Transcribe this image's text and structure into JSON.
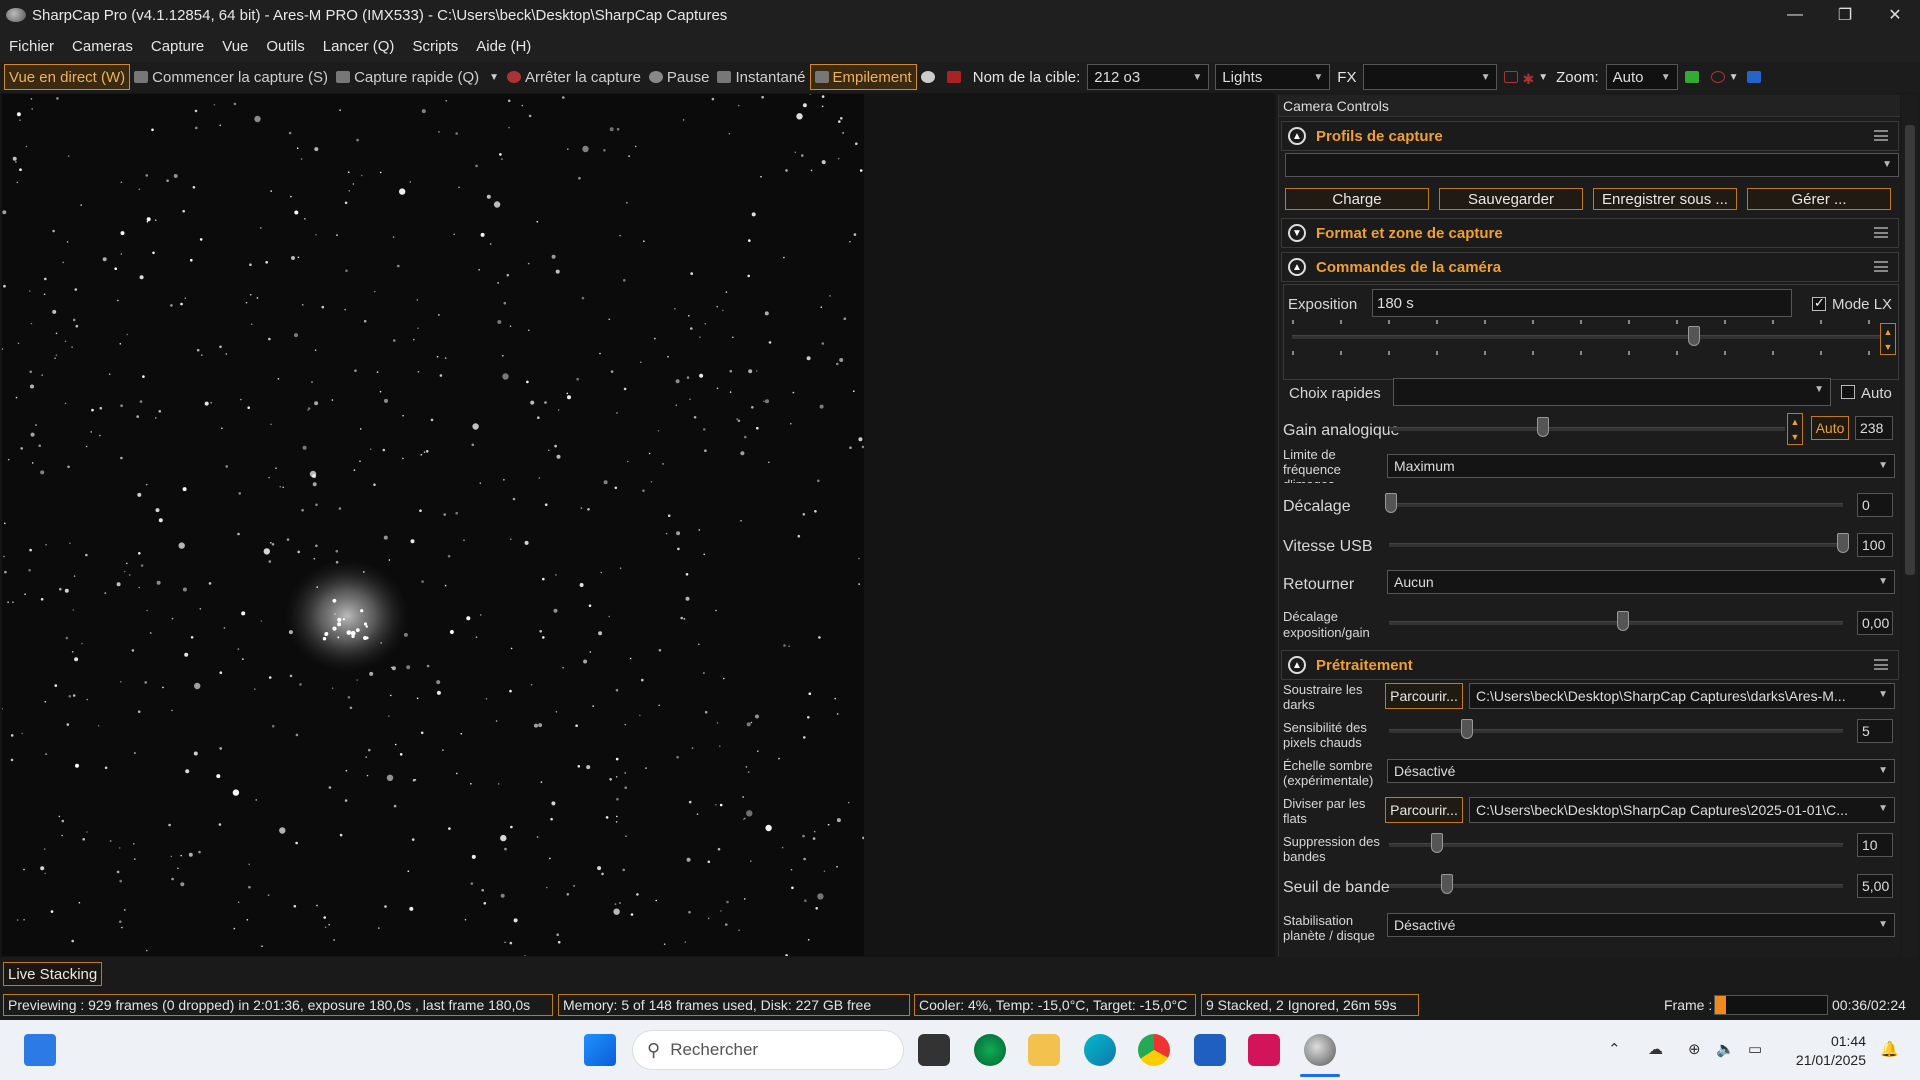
{
  "window": {
    "title": "SharpCap Pro (v4.1.12854, 64 bit) - Ares-M PRO (IMX533) - C:\\Users\\beck\\Desktop\\SharpCap Captures",
    "minimize_glyph": "—",
    "maximize_glyph": "❐",
    "close_glyph": "✕"
  },
  "menu": [
    "Fichier",
    "Cameras",
    "Capture",
    "Vue",
    "Outils",
    "Lancer (Q)",
    "Scripts",
    "Aide (H)"
  ],
  "toolbar": {
    "live_view": "Vue en direct (W)",
    "start_capture": "Commencer la capture (S)",
    "quick_capture": "Capture rapide (Q)",
    "stop_capture": "Arrêter la capture",
    "pause": "Pause",
    "snapshot": "Instantané",
    "stacking": "Empilement",
    "target_label": "Nom de la cible:",
    "target_value": "212 o3",
    "frame_type": "Lights",
    "fx_label": "FX",
    "fx_value": "",
    "zoom_label": "Zoom:",
    "zoom_value": "Auto"
  },
  "panel": {
    "title": "Camera Controls",
    "sections": {
      "profiles": "Profils de capture",
      "format": "Format et zone de capture",
      "camera_controls": "Commandes de la caméra",
      "preprocessing": "Prétraitement"
    },
    "profile_buttons": [
      "Charge",
      "Sauvegarder",
      "Enregistrer sous ...",
      "Gérer ..."
    ],
    "exposure": {
      "label": "Exposition",
      "value": "180 s",
      "lx_label": "Mode LX",
      "lx_checked": true
    },
    "quick_choice": {
      "label": "Choix rapides",
      "value": "",
      "auto_label": "Auto"
    },
    "gain": {
      "label": "Gain analogique",
      "auto_label": "Auto",
      "value": "238"
    },
    "frame_rate": {
      "label": "Limite de fréquence d'images",
      "value": "Maximum"
    },
    "offset": {
      "label": "Décalage",
      "value": "0"
    },
    "usb_speed": {
      "label": "Vitesse USB",
      "value": "100"
    },
    "flip": {
      "label": "Retourner",
      "value": "Aucun"
    },
    "exp_gain_offset": {
      "label": "Décalage exposition/gain",
      "value": "0,00"
    },
    "subtract_darks": {
      "label": "Soustraire les darks",
      "browse": "Parcourir...",
      "path": "C:\\Users\\beck\\Desktop\\SharpCap Captures\\darks\\Ares-M..."
    },
    "hot_pixel": {
      "label": "Sensibilité des pixels chauds",
      "value": "5"
    },
    "dark_scale": {
      "label": "Échelle sombre (expérimentale)",
      "value": "Désactivé"
    },
    "divide_flats": {
      "label": "Diviser par les flats",
      "browse": "Parcourir...",
      "path": "C:\\Users\\beck\\Desktop\\SharpCap Captures\\2025-01-01\\C..."
    },
    "banding": {
      "label": "Suppression des bandes",
      "value": "10"
    },
    "band_threshold": {
      "label": "Seuil de bande",
      "value": "5,00"
    },
    "planet_stab": {
      "label": "Stabilisation planète / disque",
      "value": "Désactivé"
    }
  },
  "live_stacking_tab": "Live Stacking",
  "status": {
    "preview": "Previewing : 929 frames (0 dropped) in 2:01:36, exposure 180,0s , last frame 180,0s",
    "memory": "Memory: 5 of 148 frames used, Disk: 227 GB free",
    "cooler": "Cooler: 4%, Temp: -15,0°C, Target: -15,0°C",
    "stacked": "9 Stacked, 2 Ignored, 26m 59s",
    "frame_label": "Frame :",
    "frame_progress": 0.1,
    "time": "00:36/02:24"
  },
  "taskbar": {
    "search_placeholder": "Rechercher",
    "time": "01:44",
    "date": "21/01/2025"
  },
  "colors": {
    "accent": "#f0a030",
    "border": "#c07a1a"
  }
}
